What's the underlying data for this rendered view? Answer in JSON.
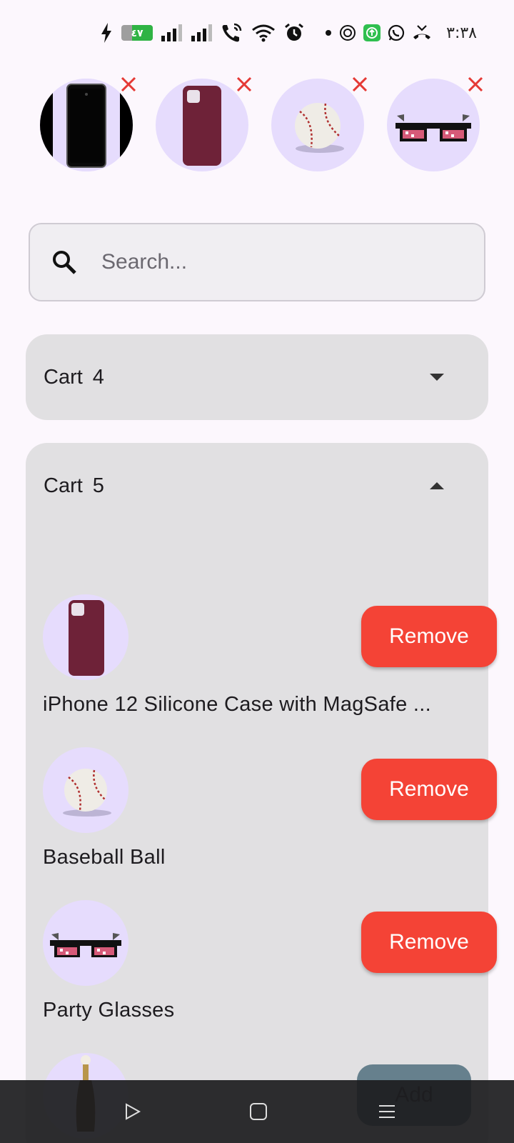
{
  "status_bar": {
    "battery_text": "٤٧",
    "clock": "٣:٣٨",
    "icons_left": [
      "charging-icon",
      "battery-icon",
      "signal-icon",
      "signal-icon",
      "wifi-calling-icon",
      "wifi-icon",
      "alarm-icon"
    ],
    "icons_right": [
      "dot-icon",
      "notification-icon",
      "upload-icon",
      "whatsapp-icon",
      "missed-call-icon"
    ]
  },
  "recent_items": [
    {
      "name": "phone",
      "icon": "phone-image"
    },
    {
      "name": "case",
      "icon": "phone-case-image"
    },
    {
      "name": "baseball",
      "icon": "baseball-image"
    },
    {
      "name": "glasses",
      "icon": "glasses-image"
    }
  ],
  "search": {
    "placeholder": "Search..."
  },
  "carts": [
    {
      "title": "Cart",
      "count": "4",
      "expanded": false
    },
    {
      "title": "Cart",
      "count": "5",
      "expanded": true
    }
  ],
  "cart_items": [
    {
      "name": "iPhone 12 Silicone Case with MagSafe ...",
      "image": "phone-case-image",
      "action": "Remove"
    },
    {
      "name": "Baseball Ball",
      "image": "baseball-image",
      "action": "Remove"
    },
    {
      "name": "Party Glasses",
      "image": "glasses-image",
      "action": "Remove"
    }
  ],
  "add_button": {
    "label": "Add"
  },
  "colors": {
    "background": "#fcf7fd",
    "panel": "#e1e0e2",
    "circle": "#e6dcfd",
    "remove": "#f44336",
    "close_x": "#e53935"
  }
}
